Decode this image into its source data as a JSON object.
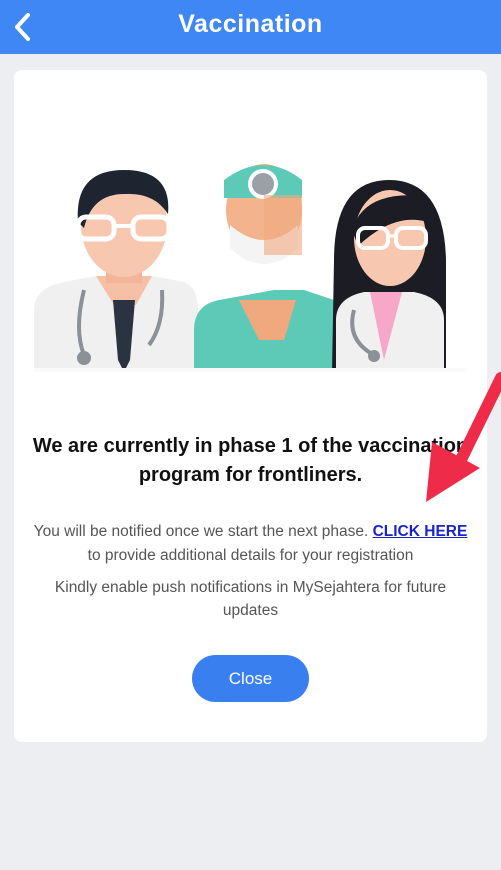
{
  "header": {
    "title": "Vaccination",
    "back_icon": "chevron-left-icon"
  },
  "dialog": {
    "illustration": "three-healthcare-workers",
    "headline": "We are currently in phase 1 of the vaccination program for frontliners.",
    "message_prefix": "You will be notified once we start the next phase. ",
    "link_label": "CLICK HERE",
    "message_suffix": " to provide additional details for your registration",
    "notify_text": "Kindly enable push notifications in MySejahtera for future updates",
    "close_label": "Close"
  },
  "overlay": {
    "arrow": "red-arrow-annotation"
  },
  "colors": {
    "header": "#3f87f4",
    "button": "#3a7ff0",
    "link": "#1b24c9",
    "arrow": "#ef2b4a"
  }
}
